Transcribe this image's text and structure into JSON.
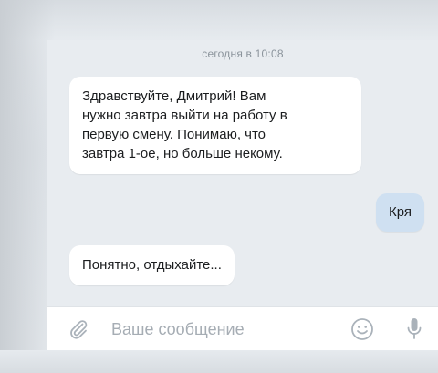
{
  "chat": {
    "date_separator": "сегодня в 10:08",
    "messages": [
      {
        "direction": "incoming",
        "lines": [
          "Здравствуйте, Дмитрий! Вам",
          "нужно завтра выйти на работу в",
          "первую смену. Понимаю, что",
          "завтра 1-ое, но больше некому."
        ]
      },
      {
        "direction": "outgoing",
        "text": "Кря"
      },
      {
        "direction": "incoming",
        "text": "Понятно, отдыхайте..."
      }
    ]
  },
  "composer": {
    "placeholder": "Ваше сообщение",
    "attach_icon": "paperclip-icon",
    "emoji_icon": "smile-icon",
    "voice_icon": "microphone-icon"
  },
  "colors": {
    "background": "#e8ecf0",
    "incoming_bubble": "#ffffff",
    "outgoing_bubble": "#cfe0f1",
    "muted_text": "#8b949c",
    "icon": "#aab2ba"
  }
}
